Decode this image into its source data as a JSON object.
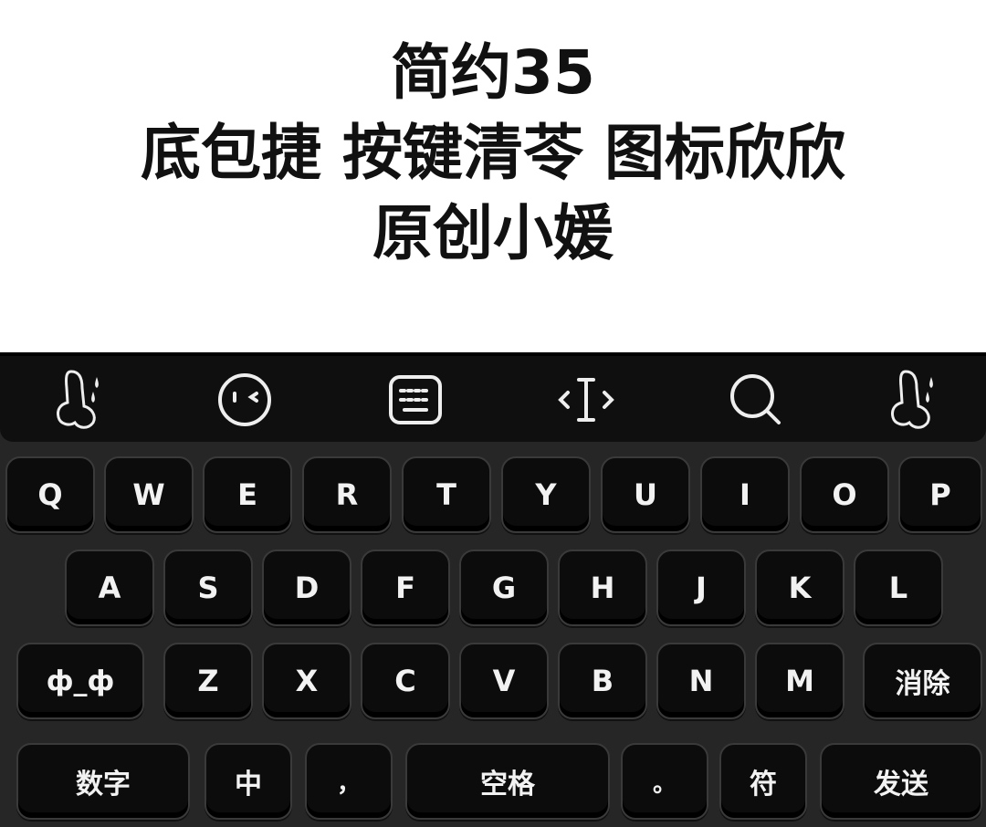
{
  "banner": {
    "line1": "简约35",
    "line2": "底包捷 按键清苓 图标欣欣",
    "line3": "原创小媛"
  },
  "toolbar": {
    "items": [
      {
        "icon": "blob-drop-icon"
      },
      {
        "icon": "emoji-face-icon"
      },
      {
        "icon": "keyboard-icon"
      },
      {
        "icon": "cursor-move-icon"
      },
      {
        "icon": "search-icon"
      },
      {
        "icon": "blob-drop-icon"
      }
    ]
  },
  "rows": {
    "row1": [
      "Q",
      "W",
      "E",
      "R",
      "T",
      "Y",
      "U",
      "I",
      "O",
      "P"
    ],
    "row2": [
      "A",
      "S",
      "D",
      "F",
      "G",
      "H",
      "J",
      "K",
      "L"
    ],
    "row3": {
      "left": "ф_ф",
      "letters": [
        "Z",
        "X",
        "C",
        "V",
        "B",
        "N",
        "M"
      ],
      "delete": "消除"
    },
    "row4": {
      "numbers": "数字",
      "lang": "中",
      "comma": "，",
      "space": "空格",
      "period": "。",
      "symbols": "符",
      "send": "发送"
    }
  },
  "colors": {
    "keyboard_bg": "#262626",
    "key_bg": "#0c0c0c",
    "key_text": "#f2f2f2"
  }
}
